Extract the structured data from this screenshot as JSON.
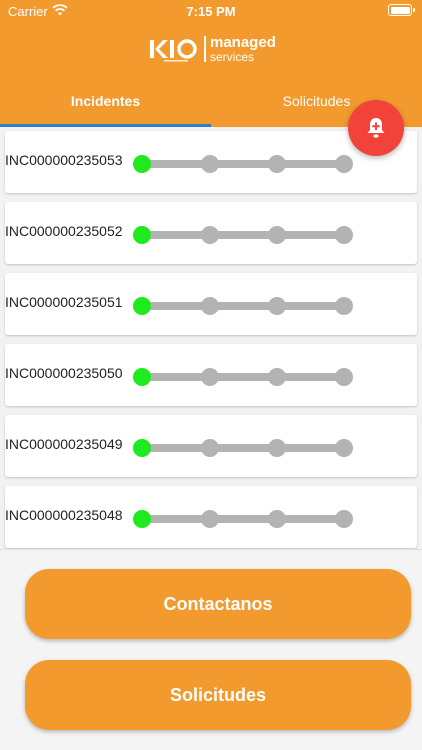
{
  "status_bar": {
    "carrier": "Carrier",
    "time": "7:15 PM"
  },
  "logo": {
    "line1": "managed",
    "line2": "services"
  },
  "tabs": [
    {
      "label": "Incidentes",
      "selected": true
    },
    {
      "label": "Solicitudes",
      "selected": false
    }
  ],
  "incidents": [
    {
      "id": "INC000000235053",
      "steps_total": 4,
      "steps_done": 1
    },
    {
      "id": "INC000000235052",
      "steps_total": 4,
      "steps_done": 1
    },
    {
      "id": "INC000000235051",
      "steps_total": 4,
      "steps_done": 1
    },
    {
      "id": "INC000000235050",
      "steps_total": 4,
      "steps_done": 1
    },
    {
      "id": "INC000000235049",
      "steps_total": 4,
      "steps_done": 1
    },
    {
      "id": "INC000000235048",
      "steps_total": 4,
      "steps_done": 1
    }
  ],
  "fab": {
    "icon": "add-alarm-bell-icon"
  },
  "buttons": {
    "contact": "Contactanos",
    "requests": "Solicitudes"
  },
  "colors": {
    "primary": "#f29a2e",
    "tab_indicator": "#2f7fd1",
    "fab": "#f2423a",
    "step_done": "#1eea1e",
    "step_pending": "#b3b3b3"
  }
}
